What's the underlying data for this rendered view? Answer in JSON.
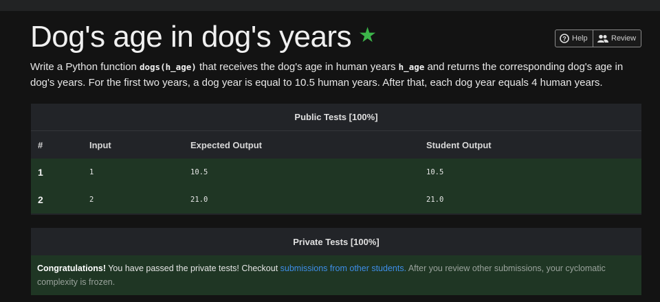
{
  "page": {
    "title": "Dog's age in dog's years",
    "star_icon": "star-icon",
    "accent_color": "#3cb54a"
  },
  "toolbar": {
    "help_label": "Help",
    "review_label": "Review"
  },
  "description": {
    "part1": "Write a Python function ",
    "code1": "dogs(h_age)",
    "part2": " that receives the dog's age in human years ",
    "code2": "h_age",
    "part3": " and returns the corresponding dog's age in dog's years. For the first two years, a dog year is equal to 10.5 human years. After that, each dog year equals 4 human years."
  },
  "public_tests": {
    "title": "Public Tests [100%]",
    "columns": [
      "#",
      "Input",
      "Expected Output",
      "Student Output"
    ],
    "rows": [
      {
        "num": "1",
        "input": "1",
        "expected": "10.5",
        "student": "10.5"
      },
      {
        "num": "2",
        "input": "2",
        "expected": "21.0",
        "student": "21.0"
      }
    ]
  },
  "private_tests": {
    "title": "Private Tests [100%]",
    "congrats": "Congratulations!",
    "message": " You have passed the private tests! Checkout ",
    "link_text": "submissions from other students.",
    "note": " After you review other submissions, your cyclomatic complexity is frozen."
  }
}
